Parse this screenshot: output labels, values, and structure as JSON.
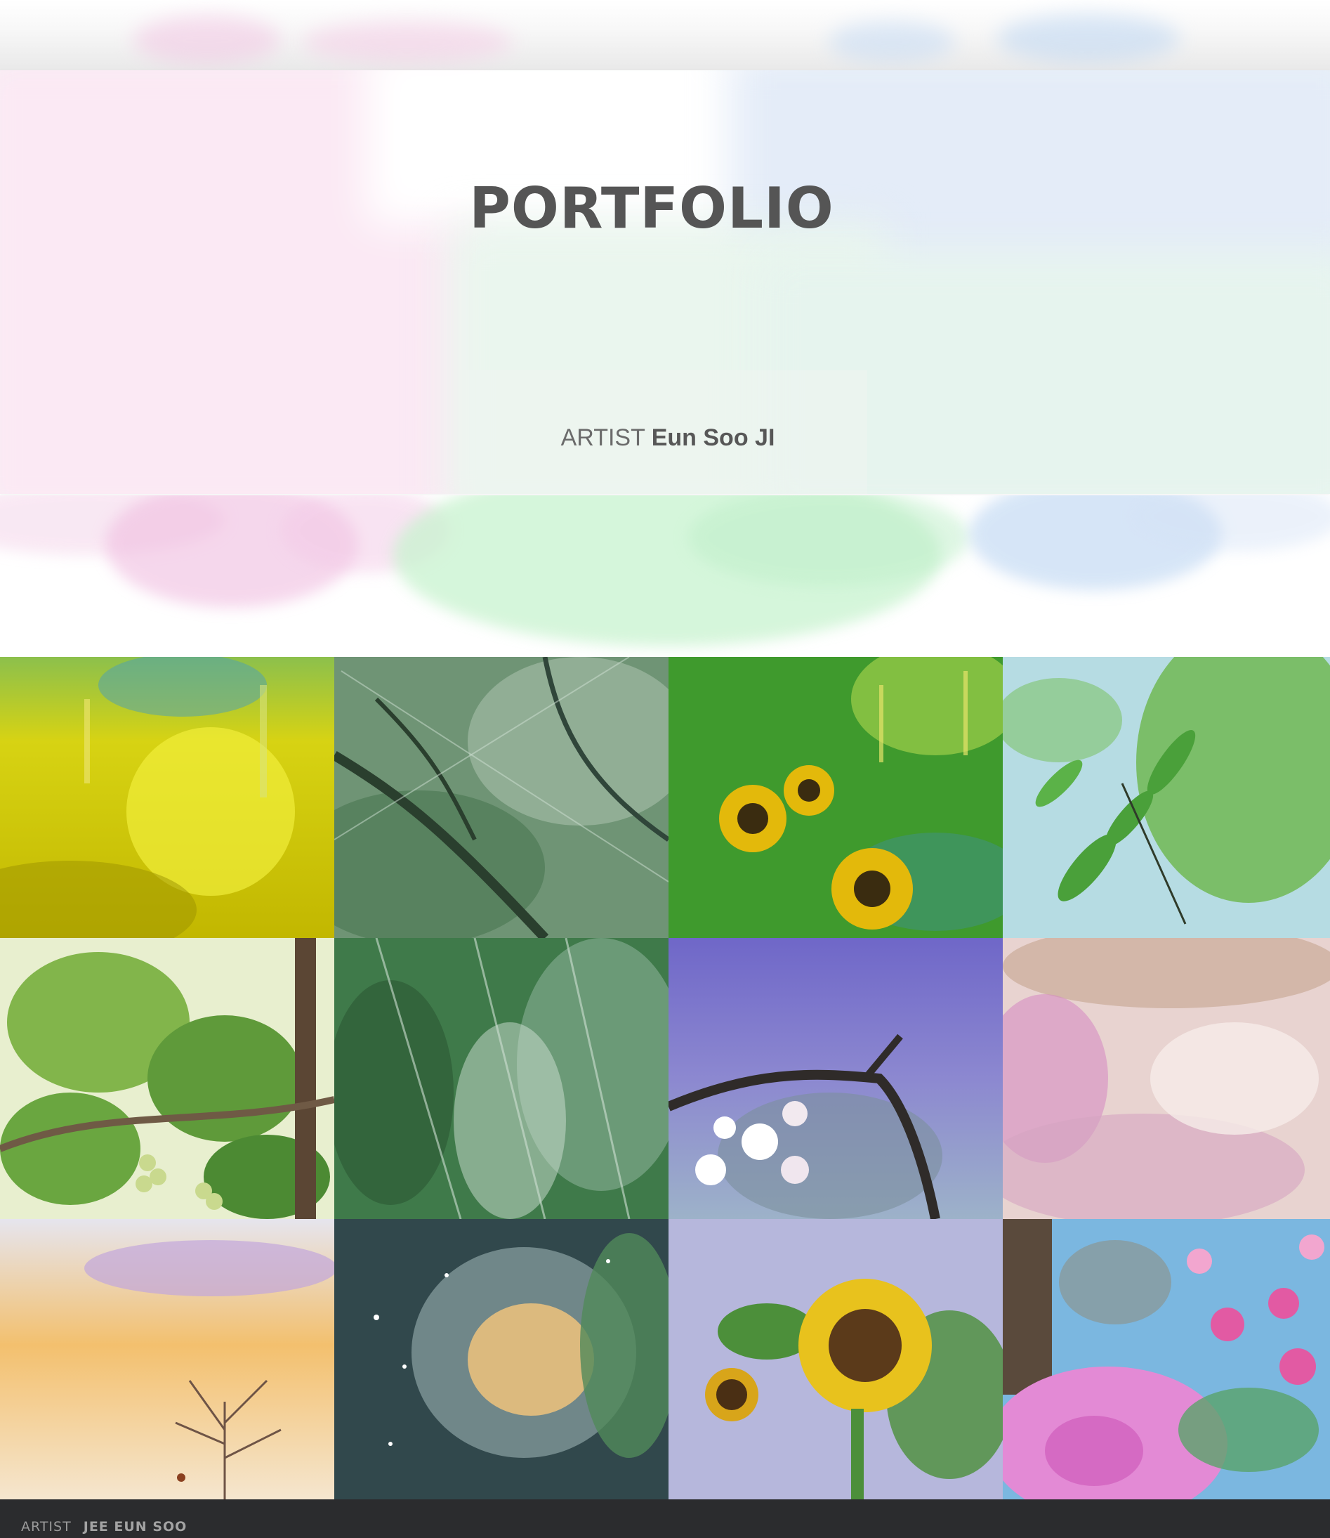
{
  "hero": {
    "title": "PORTFOLIO",
    "artist_label": "ARTIST",
    "artist_name": "Eun Soo JI"
  },
  "gallery": {
    "tiles": [
      {
        "subject": "yellow-green abstract wash",
        "palette": [
          "#e3d80a",
          "#c9c000",
          "#6aa640",
          "#3a8fb0"
        ]
      },
      {
        "subject": "green grass with dark branches",
        "palette": [
          "#4f7a55",
          "#88a98a",
          "#2a3f2e",
          "#b5c8b7"
        ]
      },
      {
        "subject": "sunflowers in green rain",
        "palette": [
          "#3f9a2d",
          "#e3b90b",
          "#2a6f2a",
          "#9fcf4a"
        ]
      },
      {
        "subject": "green leaves on blue wash",
        "palette": [
          "#59a83d",
          "#b6dce3",
          "#2f7f2f",
          "#8dcf60"
        ]
      },
      {
        "subject": "grape vine leaves and grapes",
        "palette": [
          "#82b54b",
          "#d9e6b9",
          "#3d6e2a",
          "#5b4634"
        ]
      },
      {
        "subject": "green grass texture",
        "palette": [
          "#3f7a4a",
          "#7fa88a",
          "#cfe0d3",
          "#2c5634"
        ]
      },
      {
        "subject": "white blossoms on purple night",
        "palette": [
          "#6f67c8",
          "#9db2c9",
          "#2f2b29",
          "#ffffff"
        ]
      },
      {
        "subject": "pink and peach speckled wash",
        "palette": [
          "#e8d3d0",
          "#d68ec3",
          "#c4a58f",
          "#f6ece9"
        ]
      },
      {
        "subject": "sunset sky with bare tree",
        "palette": [
          "#f3c06e",
          "#c2a6dc",
          "#e6e5ee",
          "#6e5446"
        ]
      },
      {
        "subject": "starry green and gold wash",
        "palette": [
          "#31484c",
          "#e8c07d",
          "#51895a",
          "#9bb3b3"
        ]
      },
      {
        "subject": "sunflowers on lavender",
        "palette": [
          "#e8c21d",
          "#5b3a1a",
          "#4c8f3a",
          "#b6b7dc"
        ]
      },
      {
        "subject": "pink peonies on blue sky",
        "palette": [
          "#e38ad5",
          "#7bb7e0",
          "#5a4a3c",
          "#e25aa3"
        ]
      }
    ]
  },
  "footer": {
    "label": "ARTIST",
    "name": "JEE EUN SOO"
  },
  "colors": {
    "title": "#555555",
    "footer_bg": "#2b2c2e",
    "pink_wash": "#f6d9ee",
    "green_wash": "#cff5d6",
    "blue_wash": "#c9dcf3"
  }
}
